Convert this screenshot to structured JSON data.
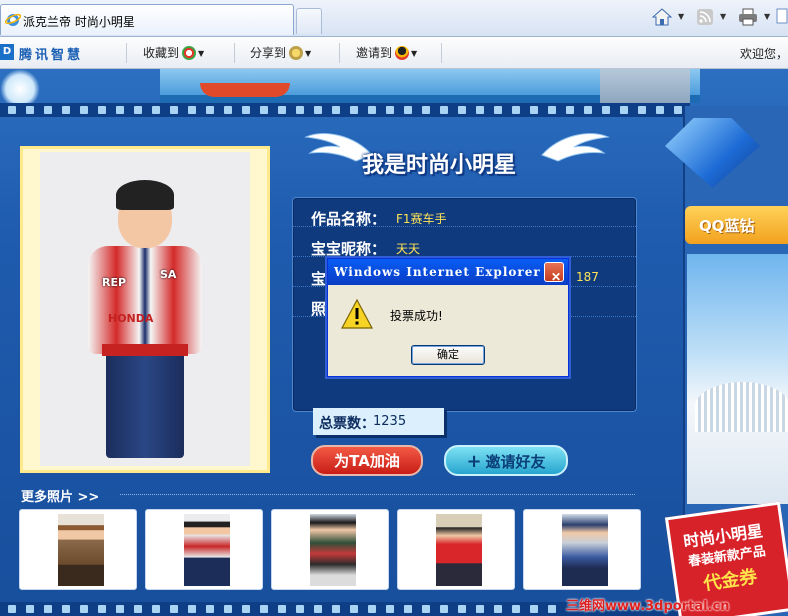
{
  "browser": {
    "tab_title": "派克兰帝 时尚小明星",
    "linkbar": {
      "brand": "腾讯智慧",
      "favorite": "收藏到",
      "share": "分享到",
      "invite": "邀请到",
      "welcome": "欢迎您，"
    }
  },
  "profile": {
    "headline": "我是时尚小明星",
    "fields": [
      {
        "label": "作品名称：",
        "value": "F1赛车手"
      },
      {
        "label": "宝宝昵称：",
        "value": "天天"
      },
      {
        "label": "宝",
        "value": "187"
      },
      {
        "label": "照",
        "value": ""
      }
    ],
    "photo_text": [
      "REP",
      "SA",
      "HONDA"
    ],
    "votes": {
      "label": "总票数：",
      "value": "1235"
    },
    "cheer_button": "为TA加油",
    "invite_button": "邀请好友",
    "more_photos": "更多照片 >>"
  },
  "side": {
    "qq_tab": "QQ蓝钻",
    "promo": [
      "时尚小明星",
      "春装新款产品",
      "代金券"
    ]
  },
  "dialog": {
    "title": "Windows Internet Explorer",
    "message": "投票成功!",
    "ok": "确定"
  },
  "watermark": "三维网www.3dportal.cn",
  "colors": {
    "page_blue": "#1f5bae",
    "dialog_title": "#0848d7",
    "value_yellow": "#ffe457",
    "cheer_red": "#c81d16",
    "invite_cyan": "#26a5cf"
  }
}
